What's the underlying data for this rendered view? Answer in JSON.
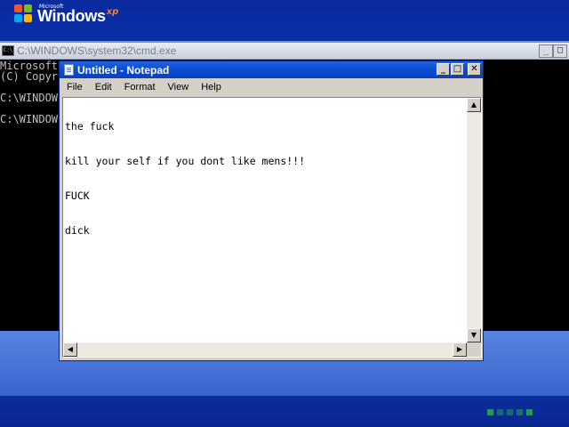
{
  "boot": {
    "logo_microsoft": "Microsoft",
    "logo_windows": "Windows",
    "logo_xp": "xp"
  },
  "cmd": {
    "title": "C:\\WINDOWS\\system32\\cmd.exe",
    "icon_label": "C:\\",
    "minimize_label": "_",
    "maximize_label": "□",
    "lines": [
      "Microsoft",
      "(C) Copyr",
      "C:\\WINDOW",
      "C:\\WINDOW"
    ]
  },
  "notepad": {
    "title": "Untitled - Notepad",
    "controls": {
      "minimize": "_",
      "maximize": "□",
      "close": "✕"
    },
    "menu": [
      "File",
      "Edit",
      "Format",
      "View",
      "Help"
    ],
    "text_lines": [
      "the fuck",
      "kill your self if you dont like mens!!!",
      "FUCK",
      "dick"
    ],
    "scroll_arrows": {
      "up": "▲",
      "down": "▼",
      "left": "◀",
      "right": "▶"
    }
  },
  "colors": {
    "title_bar_active": "#0a4bd6",
    "console_bg": "#000000",
    "console_text": "#c0c0c0",
    "progress_green": "#2fa84f"
  }
}
